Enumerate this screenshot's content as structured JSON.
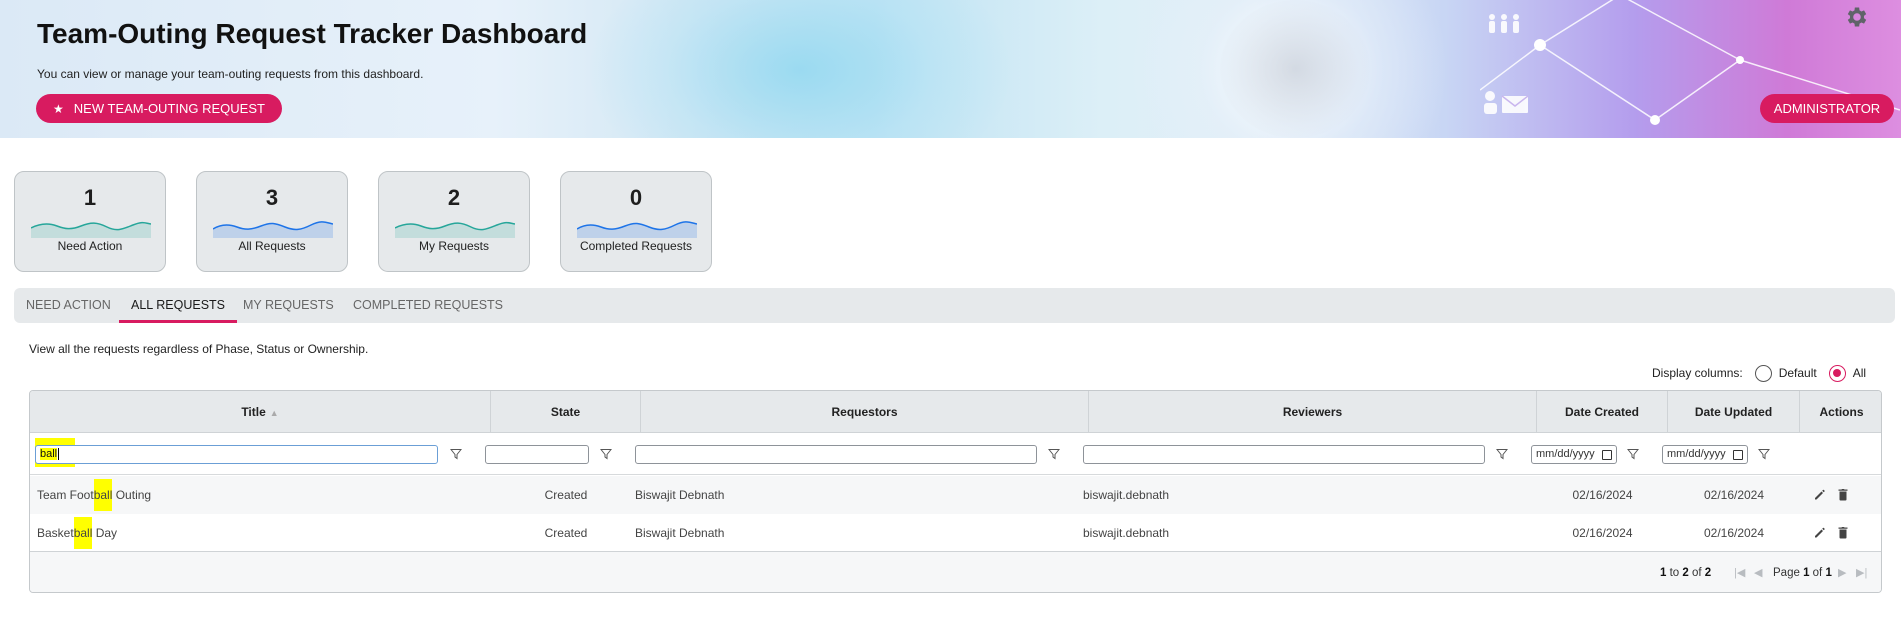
{
  "banner": {
    "title": "Team-Outing Request Tracker Dashboard",
    "subtitle": "You can view or manage your team-outing requests from this dashboard.",
    "new_request_label": "NEW TEAM-OUTING REQUEST",
    "admin_label": "ADMINISTRATOR"
  },
  "cards": [
    {
      "count": "1",
      "label": "Need Action",
      "sparkline_color": "#26a69a"
    },
    {
      "count": "3",
      "label": "All Requests",
      "sparkline_color": "#1e74e8"
    },
    {
      "count": "2",
      "label": "My Requests",
      "sparkline_color": "#26a69a"
    },
    {
      "count": "0",
      "label": "Completed Requests",
      "sparkline_color": "#1e74e8"
    }
  ],
  "tabs": [
    {
      "label": "NEED ACTION",
      "active": false
    },
    {
      "label": "ALL REQUESTS",
      "active": true
    },
    {
      "label": "MY REQUESTS",
      "active": false
    },
    {
      "label": "COMPLETED REQUESTS",
      "active": false
    }
  ],
  "tab_description": "View all the requests regardless of Phase, Status or Ownership.",
  "display_columns": {
    "label": "Display columns:",
    "options": [
      "Default",
      "All"
    ],
    "selected": "All"
  },
  "grid": {
    "columns": [
      "Title",
      "State",
      "Requestors",
      "Reviewers",
      "Date Created",
      "Date Updated",
      "Actions"
    ],
    "filters": {
      "title": "ball",
      "date_placeholder": "mm/dd/yyyy"
    },
    "rows": [
      {
        "title_pre": "Team Foot",
        "title_match": "ball",
        "title_post": " Outing",
        "state": "Created",
        "requestors": "Biswajit Debnath",
        "reviewers": "biswajit.debnath",
        "date_created": "02/16/2024",
        "date_updated": "02/16/2024"
      },
      {
        "title_pre": "Basket",
        "title_match": "ball",
        "title_post": " Day",
        "state": "Created",
        "requestors": "Biswajit Debnath",
        "reviewers": "biswajit.debnath",
        "date_created": "02/16/2024",
        "date_updated": "02/16/2024"
      }
    ],
    "pagination": {
      "range_from": "1",
      "range_to": "2",
      "total": "2",
      "page_label": "Page",
      "page": "1",
      "page_total": "1"
    }
  },
  "colors": {
    "accent": "#d81b60",
    "highlight": "#ffff00"
  }
}
